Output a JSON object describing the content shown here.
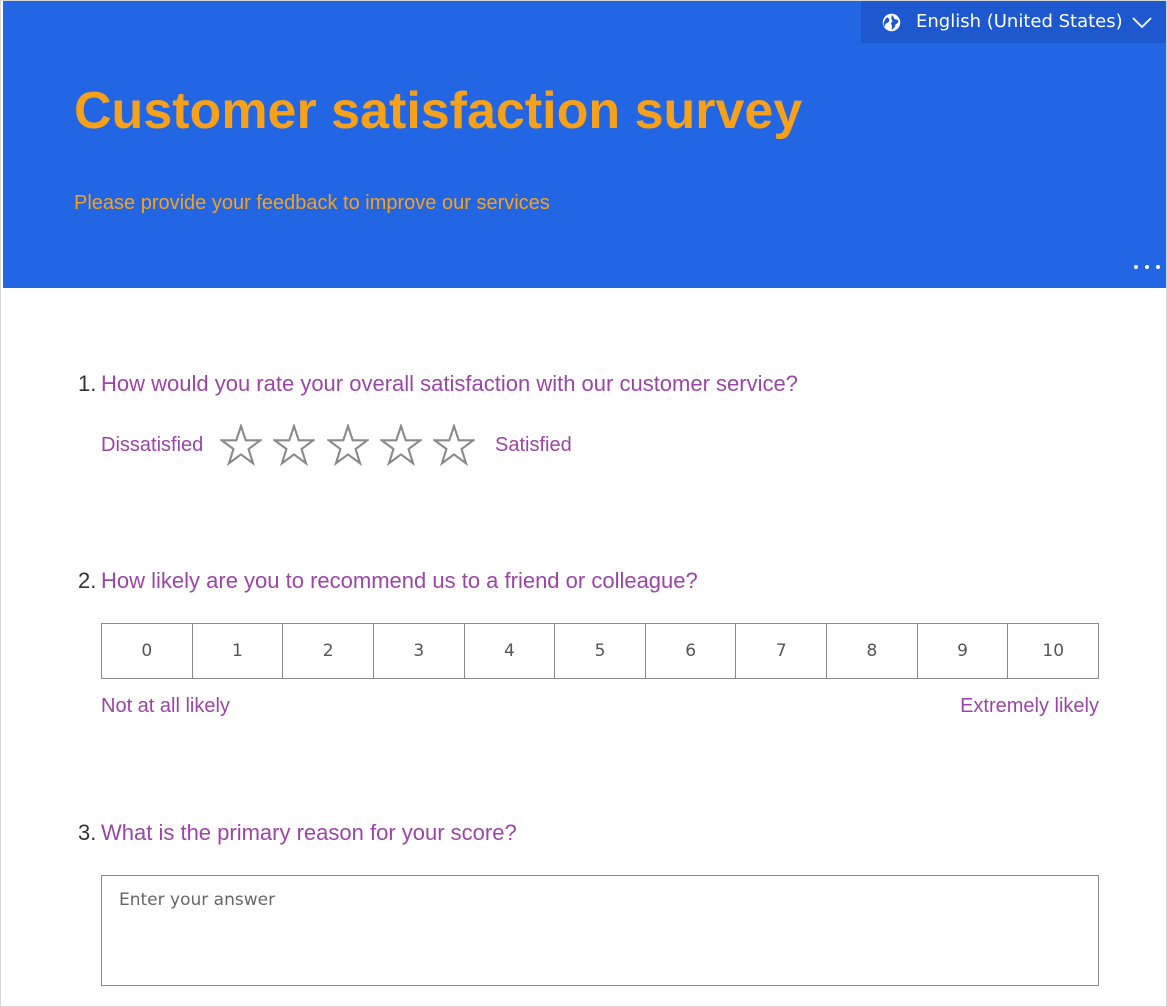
{
  "header": {
    "language": "English (United States)",
    "title": "Customer satisfaction survey",
    "subtitle": "Please provide your feedback to improve our services",
    "more_label": "..."
  },
  "colors": {
    "banner": "#2366e4",
    "title": "#f7a11a",
    "question": "#9b46a6"
  },
  "questions": [
    {
      "number": "1.",
      "text": "How would you rate your overall satisfaction with our customer service?",
      "type": "rating",
      "low_label": "Dissatisfied",
      "high_label": "Satisfied",
      "max": 5,
      "value": 0
    },
    {
      "number": "2.",
      "text": "How likely are you to recommend us to a friend or colleague?",
      "type": "nps",
      "options": [
        "0",
        "1",
        "2",
        "3",
        "4",
        "5",
        "6",
        "7",
        "8",
        "9",
        "10"
      ],
      "low_label": "Not at all likely",
      "high_label": "Extremely likely"
    },
    {
      "number": "3.",
      "text": "What is the primary reason for your score?",
      "type": "text",
      "placeholder": "Enter your answer",
      "value": ""
    }
  ],
  "icons": {
    "language": "globe-icon",
    "dropdown": "chevron-down-icon",
    "more": "more-dots-icon",
    "rating": "star-outline-icon"
  }
}
